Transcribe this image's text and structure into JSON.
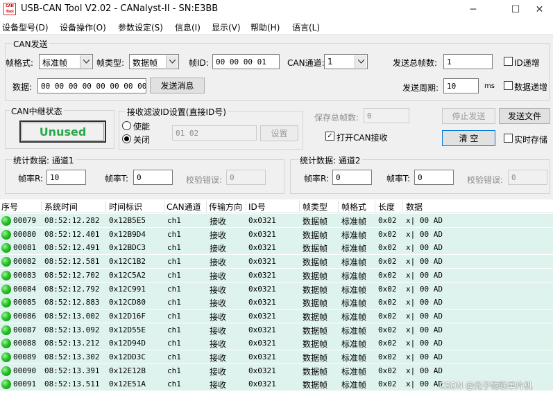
{
  "window": {
    "icon_text": "CAN Tool",
    "title": "USB-CAN Tool V2.02 - CANalyst-II - SN:E3BB",
    "minimize_glyph": "─",
    "maximize_glyph": "☐",
    "close_glyph": "✕"
  },
  "menu": [
    "设备型号(D)",
    "设备操作(O)",
    "参数设定(S)",
    "信息(I)",
    "显示(V)",
    "帮助(H)",
    "语言(L)"
  ],
  "can_send": {
    "group_title": "CAN发送",
    "frame_format_label": "帧格式:",
    "frame_format_value": "标准帧",
    "frame_type_label": "帧类型:",
    "frame_type_value": "数据帧",
    "frame_id_label": "帧ID:",
    "frame_id_value": "00 00 00 01",
    "channel_label": "CAN通道:",
    "channel_value": "1",
    "total_frames_label": "发送总帧数:",
    "total_frames_value": "1",
    "id_increment_label": "ID递增",
    "data_label": "数据:",
    "data_value": "00 00 00 00 00 00 00 00",
    "send_button": "发送消息",
    "period_label": "发送周期:",
    "period_value": "10",
    "period_unit": "ms",
    "data_increment_label": "数据递增"
  },
  "relay": {
    "group_title": "CAN中继状态",
    "status": "Unused",
    "status_color": "#2aa84a"
  },
  "filter": {
    "group_title": "接收滤波ID设置(直接ID号)",
    "enable_label": "使能",
    "disable_label": "关闭",
    "selected": "关闭",
    "id_value": "01 02",
    "set_button": "设置"
  },
  "save": {
    "total_label": "保存总帧数:",
    "total_value": "0",
    "open_can_receive_label": "打开CAN接收",
    "open_can_receive_checked": true
  },
  "actions": {
    "stop_send": "停止发送",
    "send_file": "发送文件",
    "clear": "清 空",
    "realtime_save": "实时存储"
  },
  "stats1": {
    "group_title": "统计数据: 通道1",
    "rate_r_label": "帧率R:",
    "rate_r_value": "10",
    "rate_t_label": "帧率T:",
    "rate_t_value": "0",
    "error_label": "校验错误:",
    "error_value": "0"
  },
  "stats2": {
    "group_title": "统计数据: 通道2",
    "rate_r_label": "帧率R:",
    "rate_r_value": "0",
    "rate_t_label": "帧率T:",
    "rate_t_value": "0",
    "error_label": "校验错误:",
    "error_value": "0"
  },
  "table": {
    "columns": [
      "序号",
      "系统时间",
      "时间标识",
      "CAN通道",
      "传输方向",
      "ID号",
      "帧类型",
      "帧格式",
      "长度",
      "数据"
    ],
    "rows": [
      [
        "00079",
        "08:52:12.282",
        "0x12B5E5",
        "ch1",
        "接收",
        "0x0321",
        "数据帧",
        "标准帧",
        "0x02",
        "x| 00 AD"
      ],
      [
        "00080",
        "08:52:12.401",
        "0x12B9D4",
        "ch1",
        "接收",
        "0x0321",
        "数据帧",
        "标准帧",
        "0x02",
        "x| 00 AD"
      ],
      [
        "00081",
        "08:52:12.491",
        "0x12BDC3",
        "ch1",
        "接收",
        "0x0321",
        "数据帧",
        "标准帧",
        "0x02",
        "x| 00 AD"
      ],
      [
        "00082",
        "08:52:12.581",
        "0x12C1B2",
        "ch1",
        "接收",
        "0x0321",
        "数据帧",
        "标准帧",
        "0x02",
        "x| 00 AD"
      ],
      [
        "00083",
        "08:52:12.702",
        "0x12C5A2",
        "ch1",
        "接收",
        "0x0321",
        "数据帧",
        "标准帧",
        "0x02",
        "x| 00 AD"
      ],
      [
        "00084",
        "08:52:12.792",
        "0x12C991",
        "ch1",
        "接收",
        "0x0321",
        "数据帧",
        "标准帧",
        "0x02",
        "x| 00 AD"
      ],
      [
        "00085",
        "08:52:12.883",
        "0x12CD80",
        "ch1",
        "接收",
        "0x0321",
        "数据帧",
        "标准帧",
        "0x02",
        "x| 00 AD"
      ],
      [
        "00086",
        "08:52:13.002",
        "0x12D16F",
        "ch1",
        "接收",
        "0x0321",
        "数据帧",
        "标准帧",
        "0x02",
        "x| 00 AD"
      ],
      [
        "00087",
        "08:52:13.092",
        "0x12D55E",
        "ch1",
        "接收",
        "0x0321",
        "数据帧",
        "标准帧",
        "0x02",
        "x| 00 AD"
      ],
      [
        "00088",
        "08:52:13.212",
        "0x12D94D",
        "ch1",
        "接收",
        "0x0321",
        "数据帧",
        "标准帧",
        "0x02",
        "x| 00 AD"
      ],
      [
        "00089",
        "08:52:13.302",
        "0x12DD3C",
        "ch1",
        "接收",
        "0x0321",
        "数据帧",
        "标准帧",
        "0x02",
        "x| 00 AD"
      ],
      [
        "00090",
        "08:52:13.391",
        "0x12E12B",
        "ch1",
        "接收",
        "0x0321",
        "数据帧",
        "标准帧",
        "0x02",
        "x| 00 AD"
      ],
      [
        "00091",
        "08:52:13.511",
        "0x12E51A",
        "ch1",
        "接收",
        "0x0321",
        "数据帧",
        "标准帧",
        "0x02",
        "x| 00 AD"
      ]
    ]
  },
  "watermark": "CSDN @光子物联单片机"
}
